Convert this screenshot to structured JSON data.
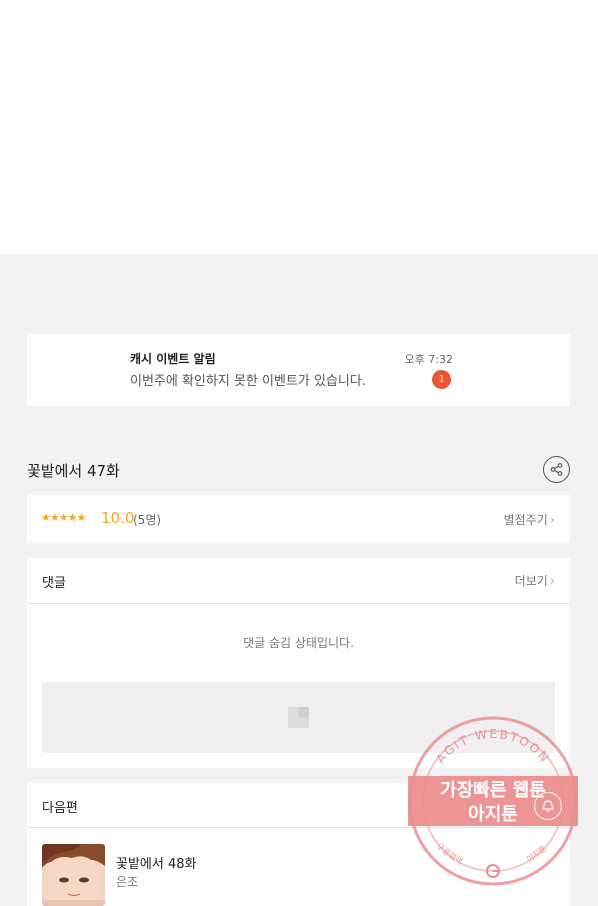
{
  "notification": {
    "title": "캐시 이벤트 알림",
    "message": "이번주에 확인하지 못한 이벤트가 있습니다.",
    "time": "오후 7:32",
    "badge": "1"
  },
  "episode": {
    "title": "꽃밭에서 47화",
    "share_icon": "share-icon"
  },
  "rating": {
    "stars": "★★★★★",
    "score": "10.0",
    "votes": "(5명)",
    "give_label": "별점주기",
    "chevron": "›"
  },
  "comments": {
    "title": "댓글",
    "more_label": "더보기",
    "chevron": "›",
    "hidden_message": "댓글 숨김 상태입니다."
  },
  "next": {
    "title": "다음편",
    "episode_title": "꽃밭에서 48화",
    "author": "은조"
  },
  "watermark": {
    "top_text": "AGIT WEBTOON",
    "line1": "가장빠른 웹툰",
    "line2": "아지툰",
    "bottom_left": "구글검색",
    "bottom_right": "아지툰"
  },
  "colors": {
    "accent_star": "#f5a623",
    "badge": "#e8552f",
    "stamp": "#e87878"
  }
}
